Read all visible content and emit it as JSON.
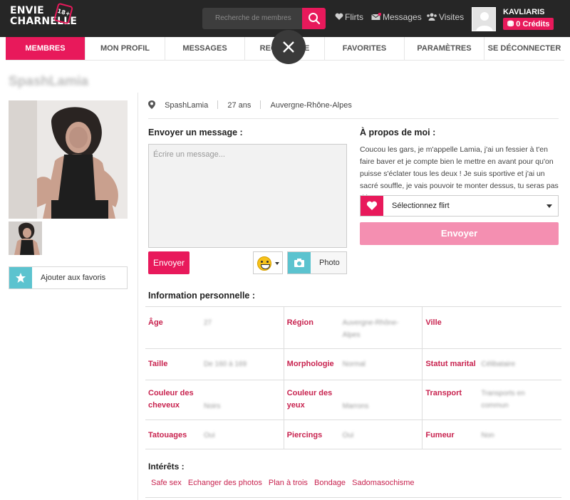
{
  "brand": {
    "line1": "ENVIE",
    "line2": "CHARNELLE",
    "age_badge": "18+"
  },
  "search": {
    "placeholder": "Recherche de membres"
  },
  "topnav": {
    "flirts": "Flirts",
    "messages": "Messages",
    "visits": "Visites"
  },
  "user": {
    "name": "KAVLIARIS",
    "credits": "0 Crédits"
  },
  "nav": [
    {
      "label": "MEMBRES",
      "active": true
    },
    {
      "label": "MON PROFIL"
    },
    {
      "label": "MESSAGES"
    },
    {
      "label": "RECHERCHE"
    },
    {
      "label": "FAVORITES"
    },
    {
      "label": "PARAMÈTRES"
    },
    {
      "label": "SE DÉCONNECTER"
    }
  ],
  "profile": {
    "title": "SpashLamia",
    "username": "SpashLamia",
    "age": "27 ans",
    "region": "Auvergne-Rhône-Alpes",
    "add_favorite": "Ajouter aux favoris"
  },
  "message": {
    "title": "Envoyer un message :",
    "placeholder": "Écrire un message...",
    "send": "Envoyer",
    "photo": "Photo"
  },
  "about": {
    "title": "À propos de moi :",
    "text": "Coucou les gars, je m'appelle Lamia, j'ai un fessier à t'en faire baver et je compte bien le mettre en avant pour qu'on puisse s'éclater tous les deux ! Je suis sportive et j'ai un sacré souffle, je vais pouvoir te monter dessus, tu seras pas déçu !",
    "flirt_select": "Sélectionnez flirt",
    "flirt_send": "Envoyer"
  },
  "personal": {
    "title": "Information personnelle :",
    "rows": [
      [
        {
          "label": "Âge",
          "value": "27"
        },
        {
          "label": "Région",
          "value": "Auvergne-Rhône-Alpes"
        },
        {
          "label": "Ville",
          "value": ""
        }
      ],
      [
        {
          "label": "Taille",
          "value": "De 160 à 169"
        },
        {
          "label": "Morphologie",
          "value": "Normal"
        },
        {
          "label": "Statut marital",
          "value": "Célibataire"
        }
      ],
      [
        {
          "label": "Couleur des cheveux",
          "value": "Noirs"
        },
        {
          "label": "Couleur des yeux",
          "value": "Marrons"
        },
        {
          "label": "Transport",
          "value": "Transports en commun"
        }
      ],
      [
        {
          "label": "Tatouages",
          "value": "Oui"
        },
        {
          "label": "Piercings",
          "value": "Oui"
        },
        {
          "label": "Fumeur",
          "value": "Non"
        }
      ]
    ]
  },
  "interests": {
    "title": "Intérêts :",
    "items": [
      "Safe sex",
      "Echanger des photos",
      "Plan à trois",
      "Bondage",
      "Sadomasochisme"
    ]
  },
  "colors": {
    "accent": "#e8195b",
    "teal": "#5cc3cf",
    "topbar": "#262626"
  }
}
